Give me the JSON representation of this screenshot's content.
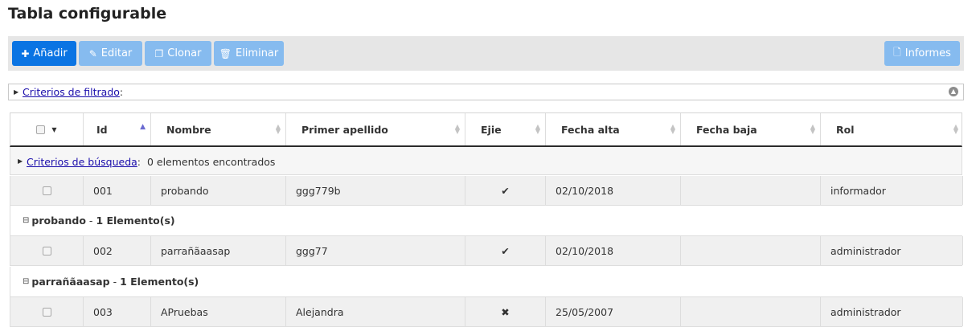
{
  "page_title": "Tabla configurable",
  "toolbar": {
    "add_label": "Añadir",
    "edit_label": "Editar",
    "clone_label": "Clonar",
    "delete_label": "Eliminar",
    "reports_label": "Informes"
  },
  "filter": {
    "link_label": "Criterios de filtrado",
    "suffix": ":"
  },
  "table": {
    "columns": [
      "Id",
      "Nombre",
      "Primer apellido",
      "Ejie",
      "Fecha alta",
      "Fecha baja",
      "Rol"
    ],
    "info": {
      "link_label": "Criterios de búsqueda",
      "suffix": ":",
      "count_text": "0 elementos encontrados"
    },
    "rows": [
      {
        "id": "001",
        "nombre": "probando",
        "apellido": "ggg779b",
        "ejie": "✔",
        "fecha_alta": "02/10/2018",
        "fecha_baja": "",
        "rol": "informador"
      },
      {
        "id": "002",
        "nombre": "parrañãaasap",
        "apellido": "ggg77",
        "ejie": "✔",
        "fecha_alta": "02/10/2018",
        "fecha_baja": "",
        "rol": "administrador"
      },
      {
        "id": "003",
        "nombre": "APruebas",
        "apellido": "Alejandra",
        "ejie": "✖",
        "fecha_alta": "25/05/2007",
        "fecha_baja": "",
        "rol": "administrador"
      }
    ],
    "groups": [
      {
        "toggle": "⊟",
        "name": "probando",
        "separator": "-",
        "count": "1 Elemento(s)"
      },
      {
        "toggle": "⊟",
        "name": "parrañãaasap",
        "separator": "-",
        "count": "1 Elemento(s)"
      }
    ]
  },
  "icons": {
    "add": "plus-icon",
    "edit": "edit-icon",
    "clone": "clone-icon",
    "delete": "trash-icon",
    "reports": "document-icon",
    "collapse": "caret-right-icon",
    "filter_toggle": "collapse-circle-icon"
  },
  "colors": {
    "primary": "#0a74e3",
    "primary_disabled": "#86bbef",
    "toolbar_bg": "#e6e6e6",
    "link": "#1a0dab"
  }
}
